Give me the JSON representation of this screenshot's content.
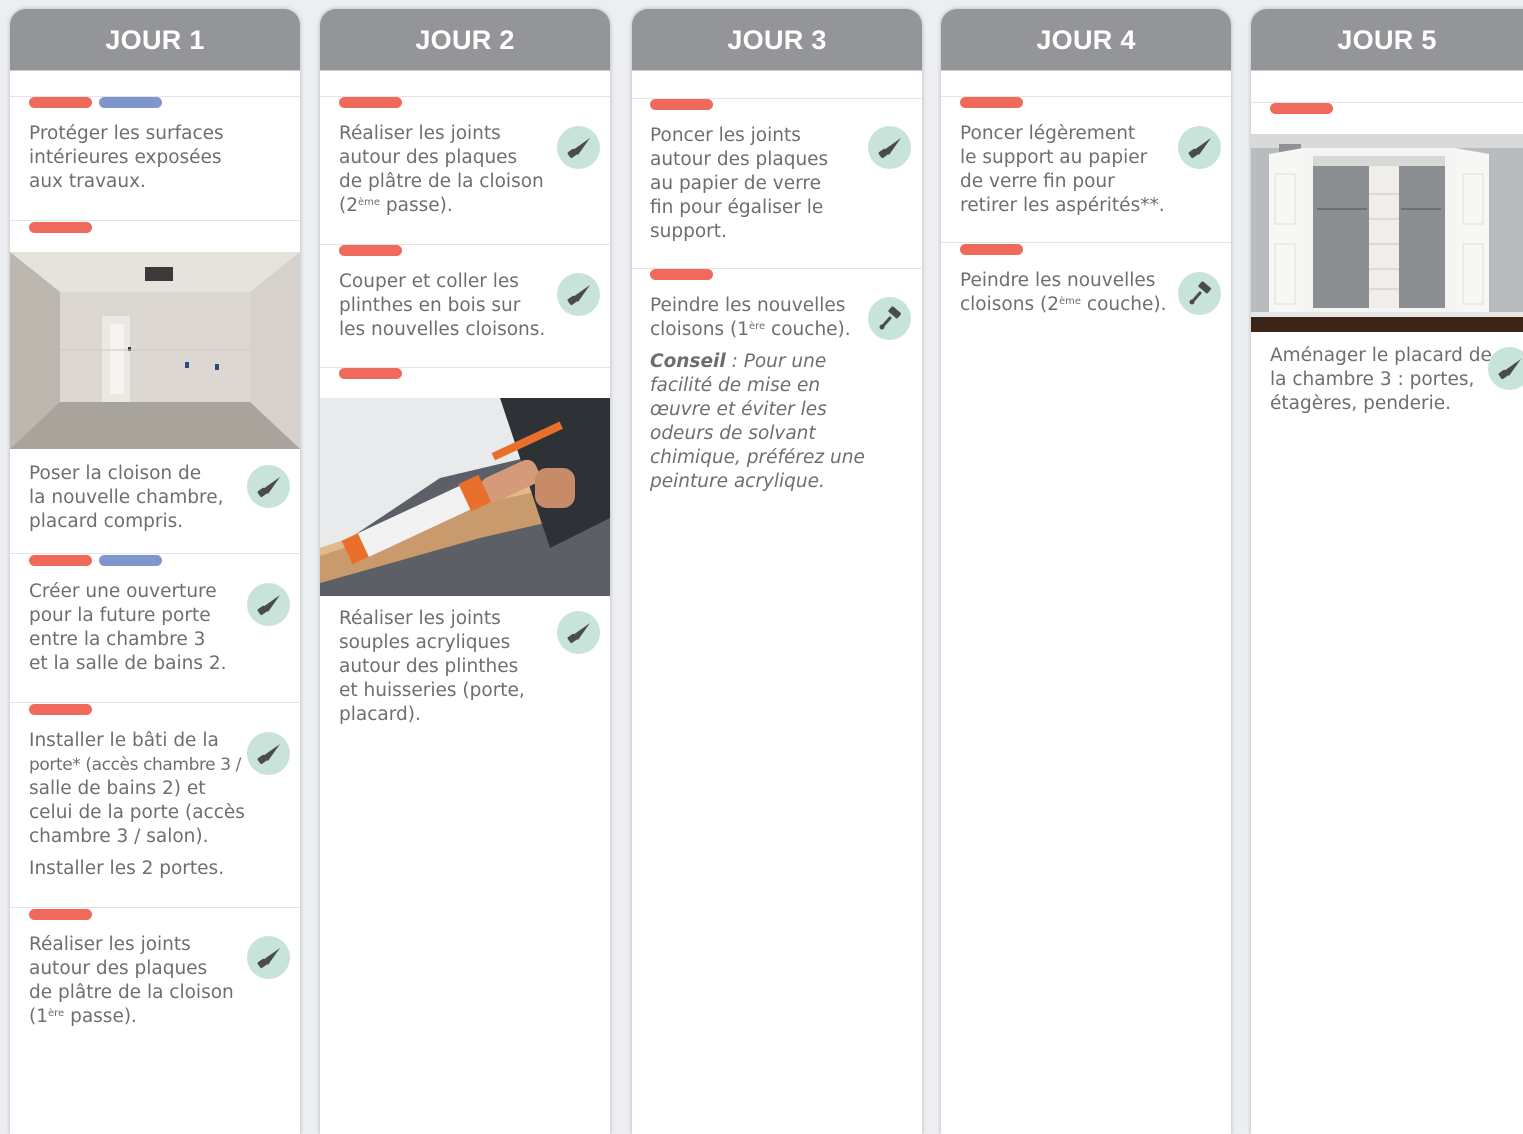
{
  "days": [
    {
      "title": "JOUR 1",
      "tasks": [
        {
          "lines": [
            "Protéger les surfaces",
            "intérieures exposées",
            "aux travaux."
          ],
          "tags": [
            "red",
            "blue"
          ],
          "icon": null
        },
        {
          "lines": [
            "Poser la cloison de",
            "la nouvelle chambre,",
            "placard compris."
          ],
          "tags": [
            "red"
          ],
          "icon": "saw-icon",
          "image": "unfinished-drywall-room-photo"
        },
        {
          "lines": [
            "Créer une ouverture",
            "pour la future porte",
            "entre la chambre 3",
            "et la salle de bains 2."
          ],
          "tags": [
            "red",
            "blue"
          ],
          "icon": "saw-icon"
        },
        {
          "lines": [
            "Installer le bâti de la",
            "porte* (accès chambre 3 /",
            "salle de bains 2) et",
            "celui de la porte (accès",
            "chambre 3 / salon)."
          ],
          "extra": "Installer les 2 portes.",
          "tags": [
            "red"
          ],
          "icon": "saw-icon"
        },
        {
          "lines": [
            "Réaliser les joints",
            "autour des plaques",
            "de plâtre de la cloison"
          ],
          "last_pre": "(1",
          "last_sup": "ère",
          "last_post": " passe).",
          "tags": [
            "red"
          ],
          "icon": "saw-icon"
        }
      ]
    },
    {
      "title": "JOUR 2",
      "tasks": [
        {
          "lines": [
            "Réaliser les joints",
            "autour des plaques",
            "de plâtre de la cloison"
          ],
          "last_pre": "(2",
          "last_sup": "ème",
          "last_post": " passe).",
          "tags": [
            "red"
          ],
          "icon": "saw-icon"
        },
        {
          "lines": [
            "Couper et coller les",
            "plinthes en bois sur",
            "les nouvelles cloisons."
          ],
          "tags": [
            "red"
          ],
          "icon": "saw-icon"
        },
        {
          "lines": [
            "Réaliser les joints",
            "souples acryliques",
            "autour des plinthes",
            "et huisseries (porte,",
            "placard)."
          ],
          "tags": [
            "red"
          ],
          "icon": "saw-icon",
          "image": "caulking-gun-baseboard-photo"
        }
      ]
    },
    {
      "title": "JOUR 3",
      "tasks": [
        {
          "lines": [
            "Poncer les joints",
            "autour des plaques",
            "au papier de verre",
            "fin pour égaliser le",
            "support."
          ],
          "tags": [
            "red"
          ],
          "icon": "saw-icon"
        },
        {
          "lines": [
            "Peindre les nouvelles"
          ],
          "last_pre": "cloisons (1",
          "last_sup": "ère",
          "last_post": " couche).",
          "tags": [
            "red"
          ],
          "icon": "paint-roller-icon",
          "tip_label": "Conseil",
          "tip_first": " : Pour une",
          "tip_lines": [
            "facilité de mise en",
            "œuvre et éviter les",
            "odeurs de solvant",
            "chimique, préférez une",
            "peinture acrylique."
          ]
        }
      ]
    },
    {
      "title": "JOUR 4",
      "tasks": [
        {
          "lines": [
            "Poncer légèrement",
            "le support au papier",
            "de verre fin pour",
            "retirer les aspérités**."
          ],
          "tags": [
            "red"
          ],
          "icon": "saw-icon"
        },
        {
          "lines": [
            "Peindre les nouvelles"
          ],
          "last_pre": "cloisons (2",
          "last_sup": "ème",
          "last_post": " couche).",
          "tags": [
            "red"
          ],
          "icon": "paint-roller-icon"
        }
      ]
    },
    {
      "title": "JOUR 5",
      "tasks": [
        {
          "lines": [
            "Aménager le placard de",
            "la chambre 3 : portes,",
            "étagères, penderie."
          ],
          "tags": [
            "red"
          ],
          "icon": "saw-icon",
          "image": "open-closet-photo"
        }
      ]
    }
  ]
}
